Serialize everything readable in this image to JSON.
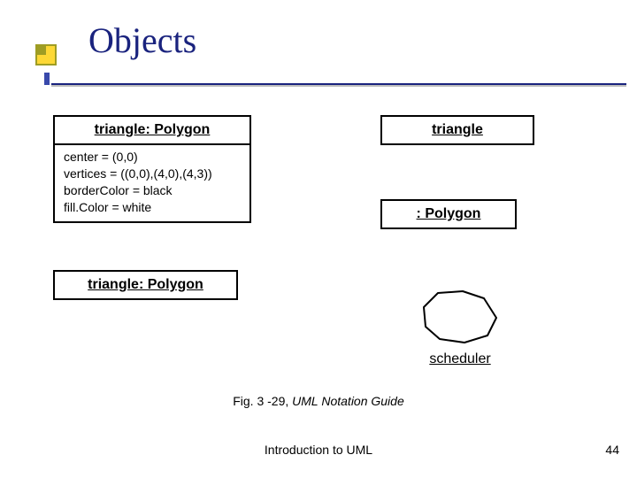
{
  "title": "Objects",
  "objects": {
    "box1": {
      "name": "triangle: Polygon",
      "attributes": [
        "center = (0,0)",
        "vertices = ((0,0),(4,0),(4,3))",
        "borderColor = black",
        "fill.Color = white"
      ]
    },
    "box2": {
      "name": "triangle: Polygon"
    },
    "box3": {
      "name": "triangle"
    },
    "box4": {
      "name": ": Polygon"
    },
    "scheduler_label": "scheduler"
  },
  "caption": {
    "prefix": "Fig. 3 -29, ",
    "italic": "UML Notation Guide"
  },
  "footer": "Introduction to UML",
  "slide_number": "44"
}
